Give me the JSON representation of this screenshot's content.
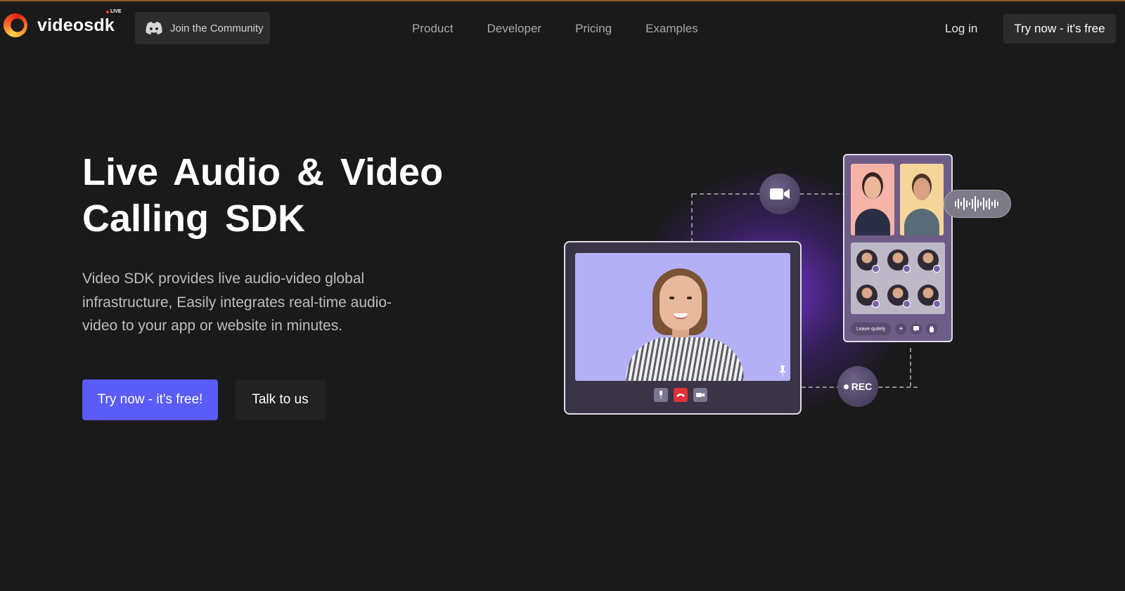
{
  "nav": {
    "logo_text": "videosdk",
    "live_badge": "LIVE",
    "community_button": "Join the Community",
    "links": [
      "Product",
      "Developer",
      "Pricing",
      "Examples"
    ],
    "login": "Log in",
    "cta": "Try now - it's free"
  },
  "hero": {
    "title_line1": "Live Audio & Video",
    "title_line2": "Calling SDK",
    "description": "Video SDK provides live audio-video global infrastructure, Easily integrates real-time audio-video to your app or website in minutes.",
    "primary_cta": "Try now - it's free!",
    "secondary_cta": "Talk to us"
  },
  "illustration": {
    "rec_label": "REC",
    "leave_label": "Leave quitely",
    "add_symbol": "+"
  },
  "colors": {
    "background": "#1a1a1a",
    "primary": "#5b5bf7",
    "nav_button": "#2c2c2c",
    "glow": "#8c3cff"
  }
}
